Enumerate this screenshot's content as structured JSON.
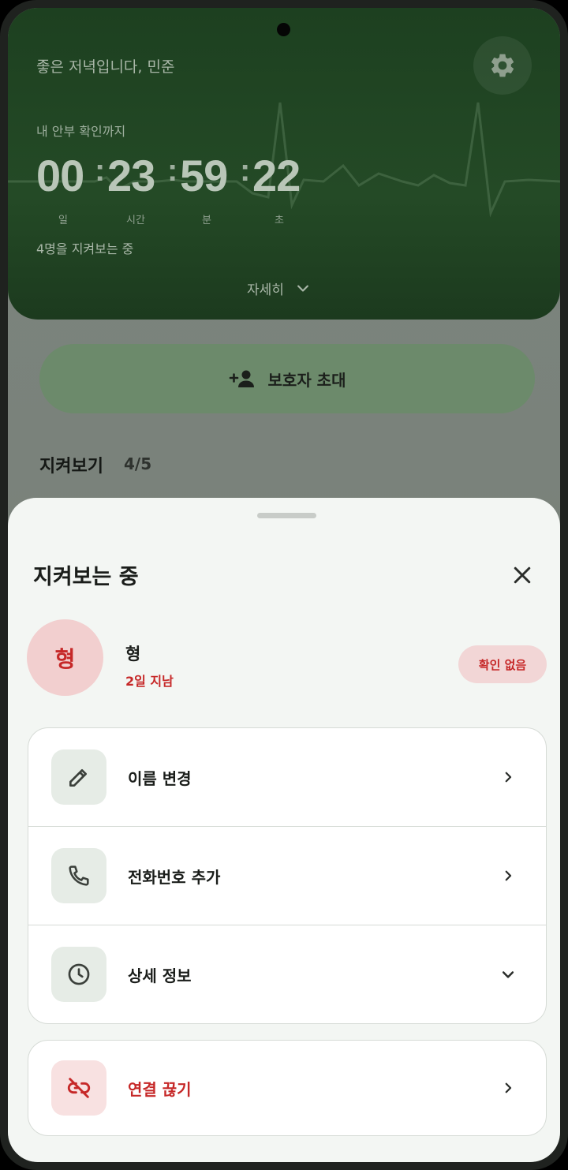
{
  "header": {
    "greeting": "좋은 저녁입니다, 민준",
    "countdown_caption": "내 안부 확인까지",
    "timer": [
      {
        "value": "00",
        "unit": "일"
      },
      {
        "value": "23",
        "unit": "시간"
      },
      {
        "value": "59",
        "unit": "분"
      },
      {
        "value": "22",
        "unit": "초"
      }
    ],
    "separator": ":",
    "watching_text": "4명을 지켜보는 중",
    "detail_label": "자세히",
    "settings_icon": "gear-icon"
  },
  "invite_button": {
    "label": "보호자 초대",
    "icon": "person-add-icon"
  },
  "watch_section": {
    "title": "지켜보기",
    "count": "4/5"
  },
  "sheet": {
    "title": "지켜보는 중",
    "person": {
      "initial": "형",
      "name": "형",
      "status": "2일 지남",
      "badge": "확인 없음"
    },
    "menu": [
      {
        "label": "이름 변경",
        "icon": "pencil-icon"
      },
      {
        "label": "전화번호 추가",
        "icon": "phone-icon"
      },
      {
        "label": "상세 정보",
        "icon": "clock-icon"
      }
    ],
    "disconnect": {
      "label": "연결 끊기",
      "icon": "link-off-icon"
    }
  },
  "colors": {
    "header_green": "#1d4020",
    "accent_red": "#c62828",
    "badge_bg": "#f2d6d6",
    "sheet_bg": "#f3f6f3"
  }
}
